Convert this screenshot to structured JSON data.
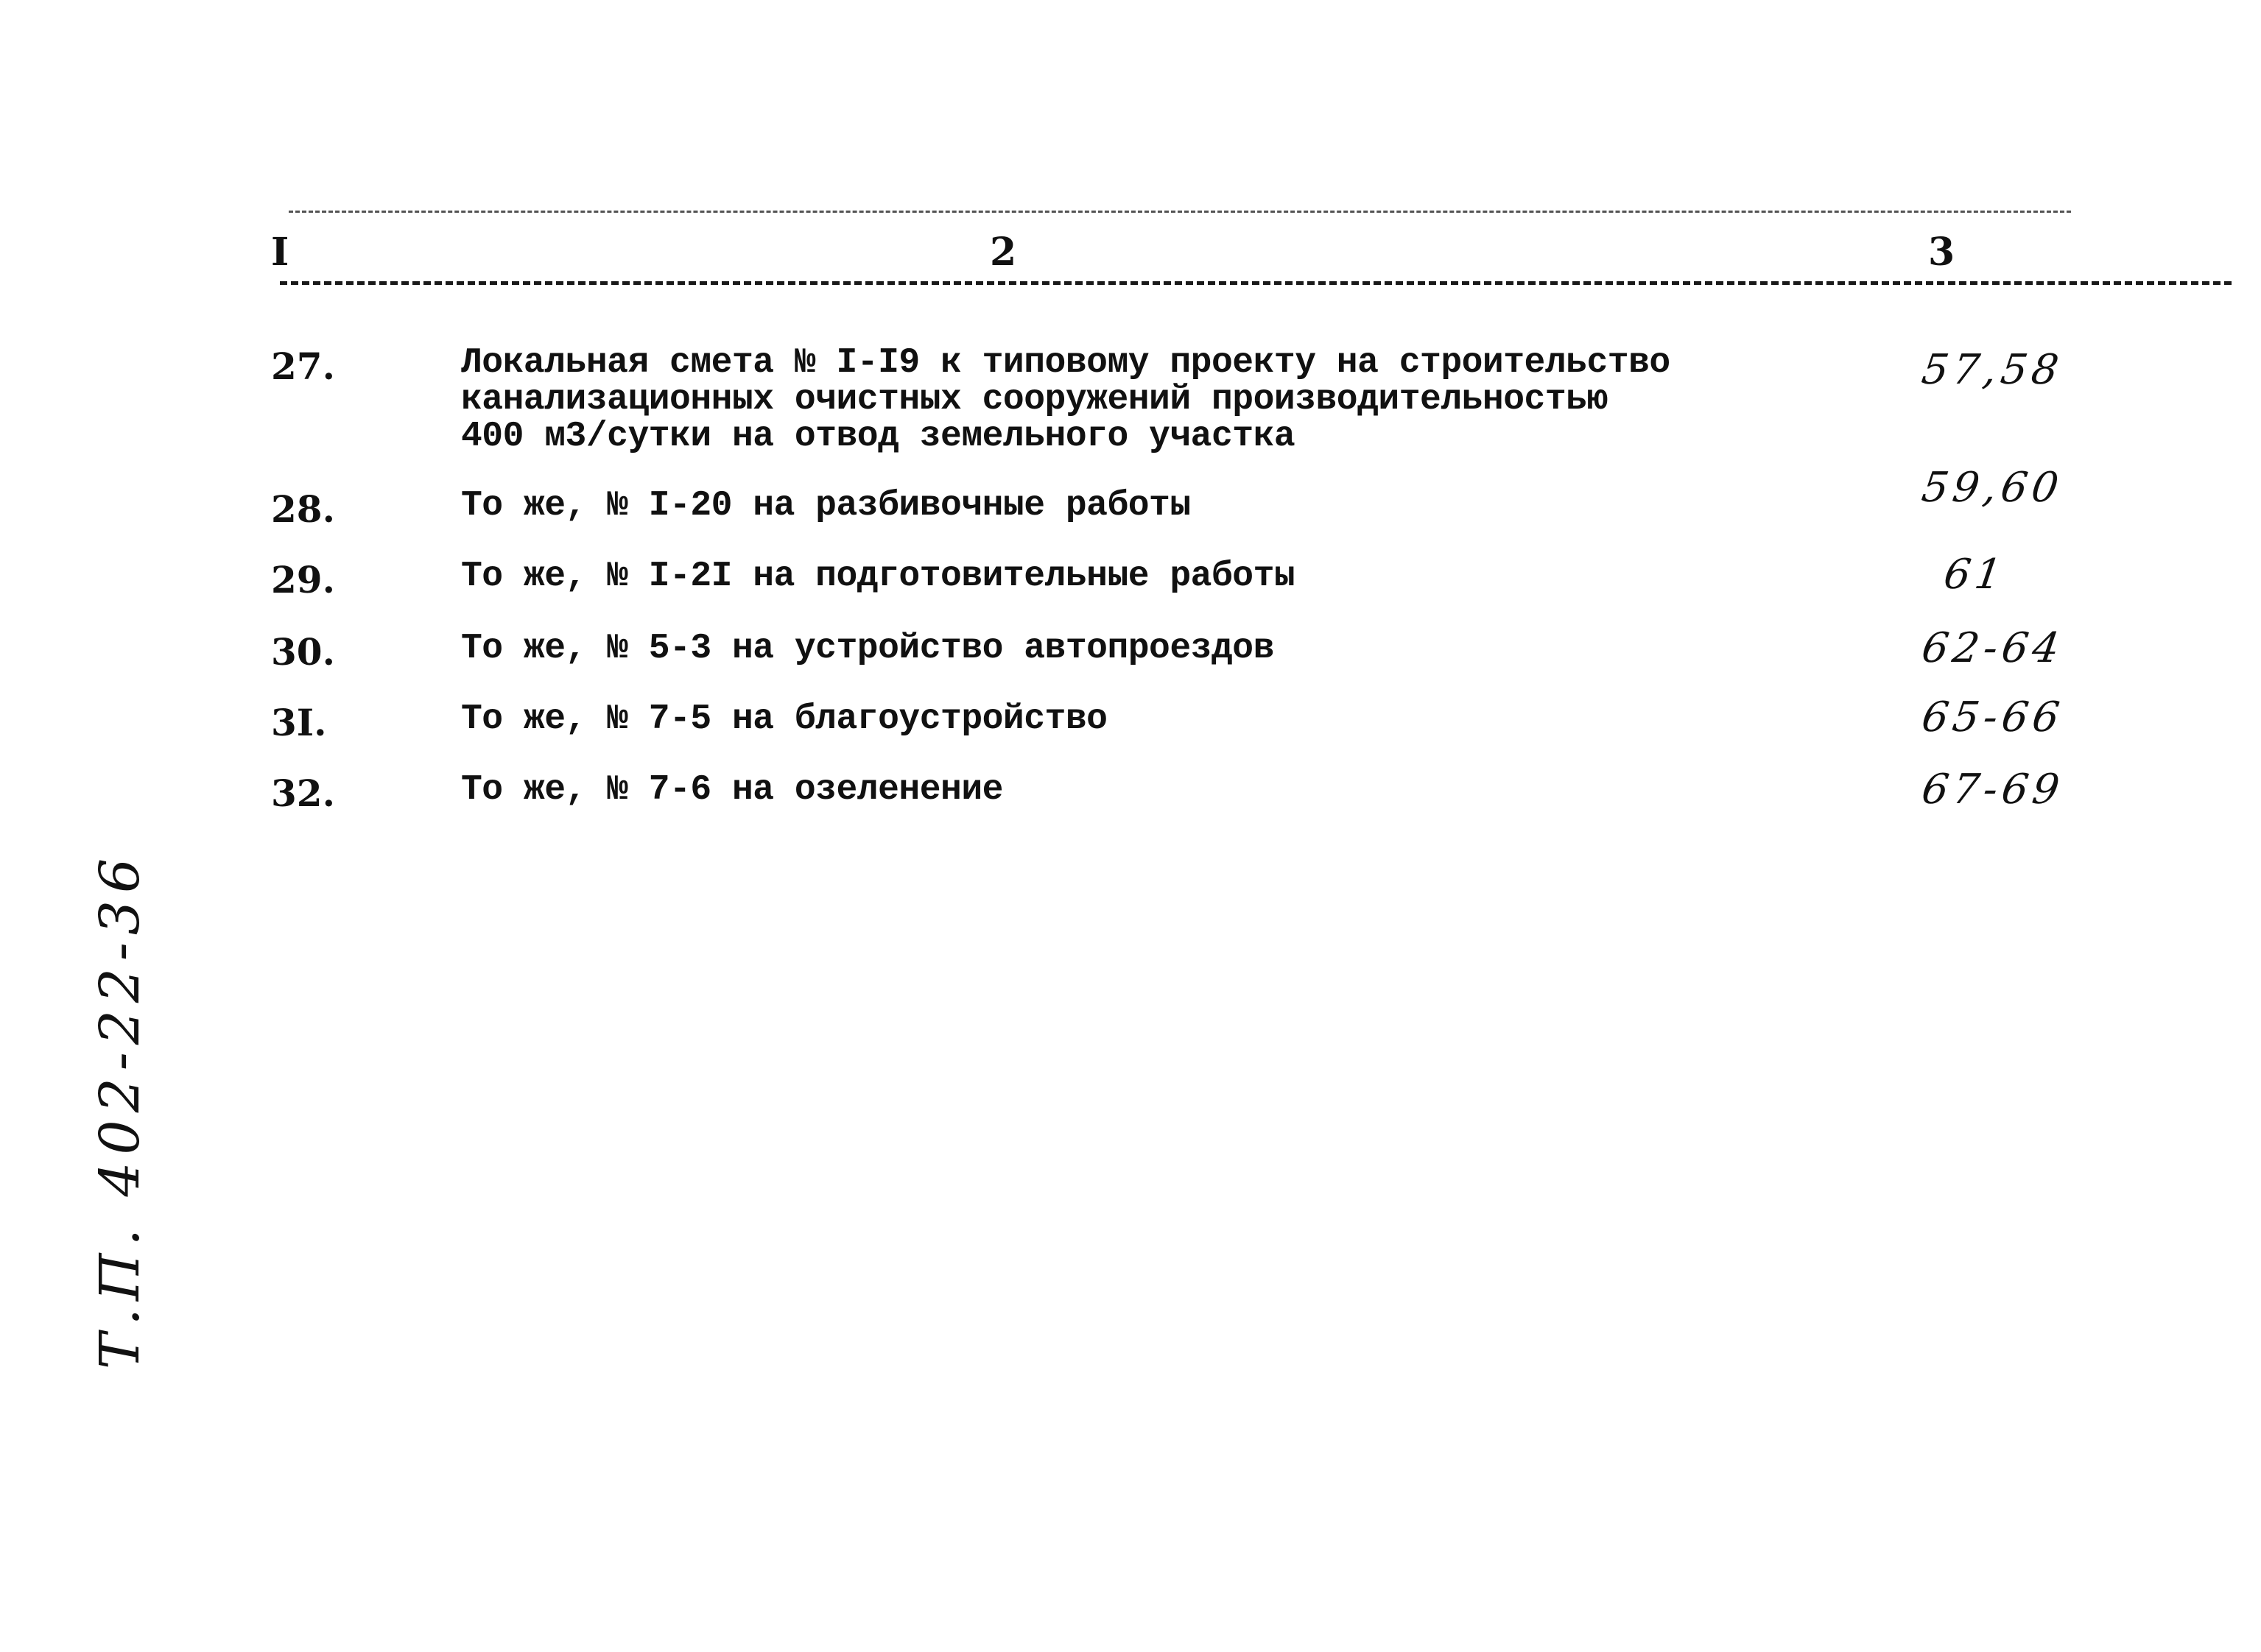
{
  "table": {
    "headers": [
      "I",
      "2",
      "3"
    ],
    "rows": [
      {
        "number": "27.",
        "description": "Локальная смета № I-I9 к типовому проекту на строительство\nканализационных очистных сооружений производительностью\n400 м3/сутки на отвод земельного участка",
        "pages": "57,58"
      },
      {
        "number": "28.",
        "description": "То же, № I-20 на разбивочные работы",
        "pages": "59,60"
      },
      {
        "number": "29.",
        "description": "То же, № I-2I на подготовительные работы",
        "pages": "61"
      },
      {
        "number": "30.",
        "description": "То же, № 5-3 на  устройство автопроездов",
        "pages": "62-64"
      },
      {
        "number": "3I.",
        "description": "То же, № 7-5 на благоустройство",
        "pages": "65-66"
      },
      {
        "number": "32.",
        "description": "То же, № 7-6 на озеленение",
        "pages": "67-69"
      }
    ]
  },
  "margin_stamp": "Т.П. 402-22-36"
}
